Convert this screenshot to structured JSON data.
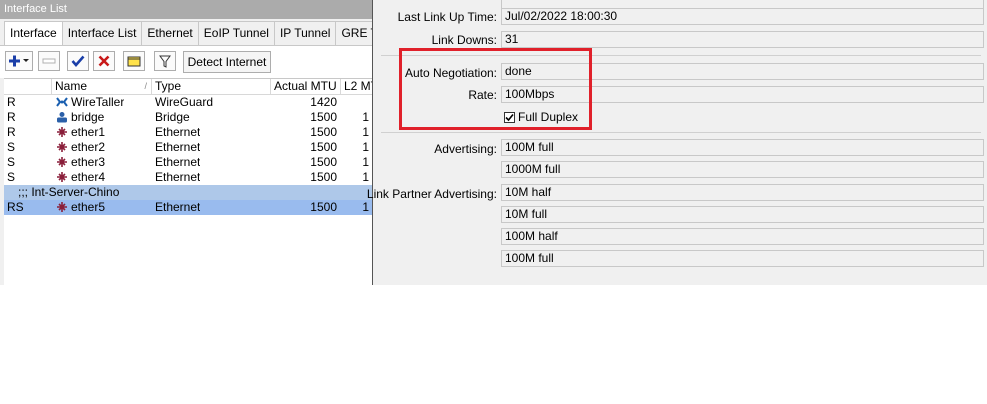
{
  "window": {
    "title": "Interface List"
  },
  "tabs": [
    "Interface",
    "Interface List",
    "Ethernet",
    "EoIP Tunnel",
    "IP Tunnel",
    "GRE Tun"
  ],
  "toolbar": {
    "detect_label": "Detect Internet"
  },
  "table": {
    "headers": [
      "",
      "Name",
      "Type",
      "Actual MTU",
      "L2 MT"
    ],
    "rows": [
      {
        "flags": "R",
        "name": "WireTaller",
        "type": "WireGuard",
        "mtu": "1420",
        "l2": ""
      },
      {
        "flags": "R",
        "name": "bridge",
        "type": "Bridge",
        "mtu": "1500",
        "l2": "1"
      },
      {
        "flags": "R",
        "name": "ether1",
        "type": "Ethernet",
        "mtu": "1500",
        "l2": "1"
      },
      {
        "flags": "S",
        "name": "ether2",
        "type": "Ethernet",
        "mtu": "1500",
        "l2": "1"
      },
      {
        "flags": "S",
        "name": "ether3",
        "type": "Ethernet",
        "mtu": "1500",
        "l2": "1"
      },
      {
        "flags": "S",
        "name": "ether4",
        "type": "Ethernet",
        "mtu": "1500",
        "l2": "1"
      }
    ],
    "comment": ";;; Int-Server-Chino",
    "selected_row": {
      "flags": "RS",
      "name": "ether5",
      "type": "Ethernet",
      "mtu": "1500",
      "l2": "1"
    }
  },
  "details": {
    "last_link_up_label": "Last Link Up Time:",
    "last_link_up_value": "Jul/02/2022 18:00:30",
    "link_downs_label": "Link Downs:",
    "link_downs_value": "31",
    "auto_neg_label": "Auto Negotiation:",
    "auto_neg_value": "done",
    "rate_label": "Rate:",
    "rate_value": "100Mbps",
    "full_duplex_label": "Full Duplex",
    "full_duplex_checked": true,
    "advertising_label": "Advertising:",
    "advertising": [
      "100M full",
      "1000M full"
    ],
    "partner_label": "Link Partner Advertising:",
    "partner": [
      "10M half",
      "10M full",
      "100M half",
      "100M full"
    ]
  },
  "colors": {
    "highlight_box": "#e0202a",
    "selected_row": "#99bbee",
    "comment_row": "#aec8e9"
  }
}
